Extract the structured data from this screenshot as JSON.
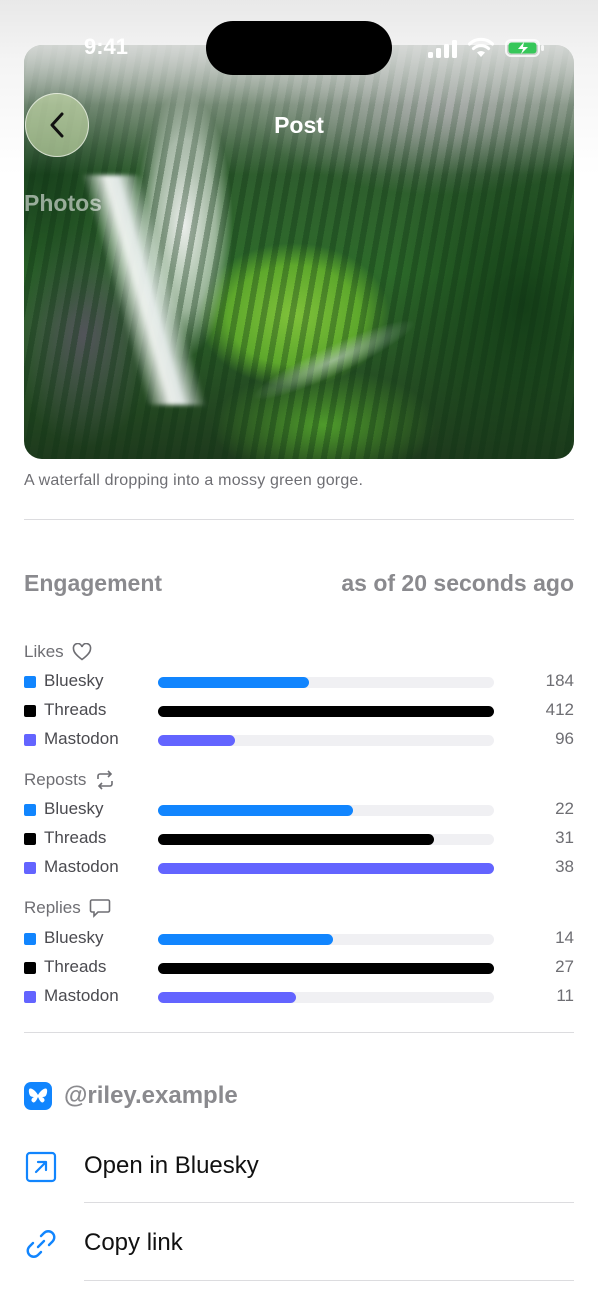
{
  "status_bar": {
    "time": "9:41"
  },
  "nav": {
    "title": "Post",
    "large_title": "Photos"
  },
  "post": {
    "caption": "A waterfall dropping into a mossy green gorge."
  },
  "engagement": {
    "title": "Engagement",
    "updated": "as of 20 seconds ago",
    "groups": [
      {
        "title": "Likes",
        "icon": "heart-icon",
        "rows": [
          {
            "name": "Bluesky",
            "value": "184",
            "fraction": 0.45,
            "color": "#1185fe"
          },
          {
            "name": "Threads",
            "value": "412",
            "fraction": 1.0,
            "color": "#000000"
          },
          {
            "name": "Mastodon",
            "value": "96",
            "fraction": 0.23,
            "color": "#6364ff"
          }
        ]
      },
      {
        "title": "Reposts",
        "icon": "repost-icon",
        "rows": [
          {
            "name": "Bluesky",
            "value": "22",
            "fraction": 0.58,
            "color": "#1185fe"
          },
          {
            "name": "Threads",
            "value": "31",
            "fraction": 0.82,
            "color": "#000000"
          },
          {
            "name": "Mastodon",
            "value": "38",
            "fraction": 1.0,
            "color": "#6364ff"
          }
        ]
      },
      {
        "title": "Replies",
        "icon": "reply-bubble-icon",
        "rows": [
          {
            "name": "Bluesky",
            "value": "14",
            "fraction": 0.52,
            "color": "#1185fe"
          },
          {
            "name": "Threads",
            "value": "27",
            "fraction": 1.0,
            "color": "#000000"
          },
          {
            "name": "Mastodon",
            "value": "11",
            "fraction": 0.41,
            "color": "#6364ff"
          }
        ]
      }
    ]
  },
  "account": {
    "handle": "@riley.example",
    "icon": "bluesky-butterfly-icon"
  },
  "actions": [
    {
      "label": "Open in Bluesky",
      "icon": "open-external-icon"
    },
    {
      "label": "Copy link",
      "icon": "link-icon"
    }
  ],
  "colors": {
    "accent": "#1185fe"
  }
}
